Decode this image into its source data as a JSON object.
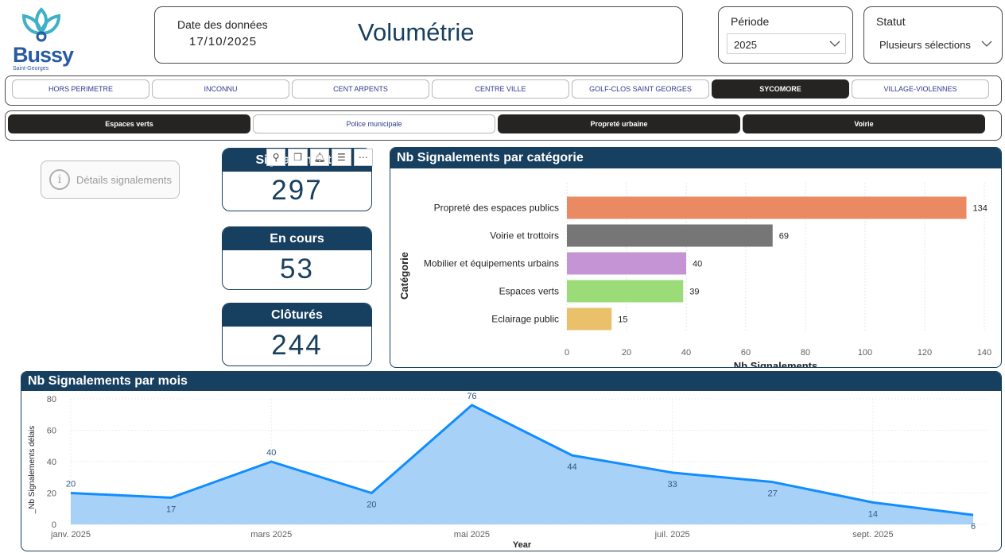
{
  "logo": {
    "name": "Bussy",
    "sub": "Saint-Georges"
  },
  "header": {
    "date_label": "Date des données",
    "date": "17/10/2025",
    "title": "Volumétrie"
  },
  "periode": {
    "label": "Période",
    "value": "2025"
  },
  "statut": {
    "label": "Statut",
    "value": "Plusieurs sélections"
  },
  "quartiers": [
    {
      "label": "HORS PERIMETRE",
      "selected": false
    },
    {
      "label": "INCONNU",
      "selected": false
    },
    {
      "label": "CENT ARPENTS",
      "selected": false
    },
    {
      "label": "CENTRE VILLE",
      "selected": false
    },
    {
      "label": "GOLF-CLOS SAINT GEORGES",
      "selected": false
    },
    {
      "label": "SYCOMORE",
      "selected": true
    },
    {
      "label": "VILLAGE-VIOLENNES",
      "selected": false
    }
  ],
  "services": [
    {
      "label": "Espaces verts",
      "selected": true
    },
    {
      "label": "Police municipale",
      "selected": false
    },
    {
      "label": "Propreté urbaine",
      "selected": true
    },
    {
      "label": "Voirie",
      "selected": true
    }
  ],
  "details_button": {
    "label": "Détails signalements",
    "icon": "info-icon"
  },
  "kpis": [
    {
      "label": "Signalements",
      "value": "297"
    },
    {
      "label": "En cours",
      "value": "53"
    },
    {
      "label": "Clôturés",
      "value": "244"
    }
  ],
  "visual_toolbar": [
    "pin-icon",
    "copy-icon",
    "bell-icon",
    "filter-icon",
    "more-icon"
  ],
  "colors": {
    "primary": "#173f5f",
    "selected": "#252423",
    "line": "#118dff",
    "area": "#a7d1f7"
  },
  "chart_data": [
    {
      "type": "bar",
      "orientation": "horizontal",
      "title": "Nb Signalements par catégorie",
      "xlabel": "Nb Signalements",
      "ylabel": "Catégorie",
      "categories": [
        "Propreté des espaces publics",
        "Voirie et trottoirs",
        "Mobilier et équipements urbains",
        "Espaces verts",
        "Eclairage public"
      ],
      "values": [
        134,
        69,
        40,
        39,
        15
      ],
      "bar_colors": [
        "#ea8a62",
        "#767676",
        "#c594d4",
        "#9bdc78",
        "#eac06a"
      ],
      "xlim": [
        0,
        140
      ],
      "xticks": [
        0,
        20,
        40,
        60,
        80,
        100,
        120,
        140
      ],
      "grid": true,
      "data_labels": true
    },
    {
      "type": "area",
      "title": "Nb Signalements par mois",
      "xlabel": "Year",
      "ylabel": "_Nb Signalements délais",
      "x": [
        "janv. 2025",
        "févr. 2025",
        "mars 2025",
        "avr. 2025",
        "mai 2025",
        "juin 2025",
        "juil. 2025",
        "août 2025",
        "sept. 2025",
        "oct. 2025"
      ],
      "xtick_labels": [
        "janv. 2025",
        "mars 2025",
        "mai 2025",
        "juil. 2025",
        "sept. 2025"
      ],
      "values": [
        20,
        17,
        40,
        20,
        76,
        44,
        33,
        27,
        14,
        6
      ],
      "ylim": [
        0,
        80
      ],
      "yticks": [
        0,
        20,
        40,
        60,
        80
      ],
      "grid": true,
      "data_labels": true
    }
  ]
}
